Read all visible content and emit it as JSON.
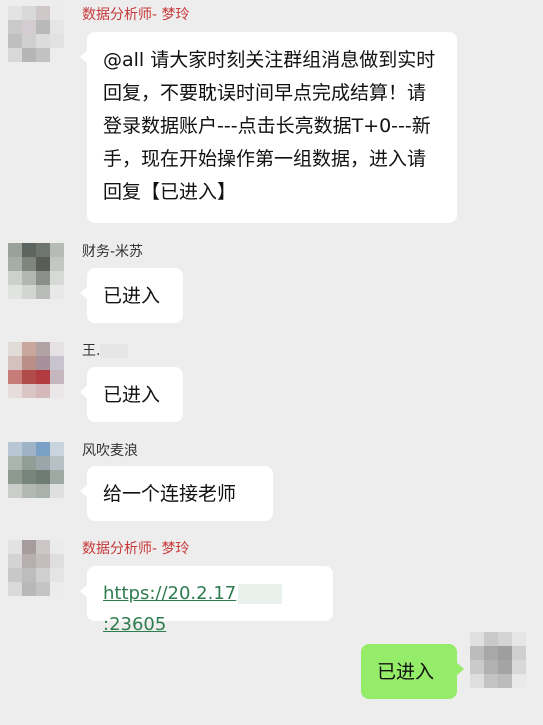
{
  "messages": [
    {
      "sender": "数据分析师- 梦玲",
      "text": "@all 请大家时刻关注群组消息做到实时回复，不要耽误时间早点完成结算！请登录数据账户---点击长亮数据T+0---新手，现在开始操作第一组数据，进入请回复【已进入】"
    },
    {
      "sender": "财务-米苏",
      "text": "已进入"
    },
    {
      "sender": "王.",
      "text": "已进入"
    },
    {
      "sender": "风吹麦浪",
      "text": "给一个连接老师"
    },
    {
      "sender": "数据分析师- 梦玲",
      "link_prefix": "https://20.2.17",
      "link_suffix": ":23605"
    },
    {
      "sender": "",
      "text": "已进入"
    }
  ],
  "colors": {
    "background": "#ededed",
    "bubble_in": "#ffffff",
    "bubble_out": "#95ec69",
    "sender_highlight": "#c8393b",
    "link": "#2e7d4f"
  },
  "icons": [
    "avatar-mosaic"
  ]
}
